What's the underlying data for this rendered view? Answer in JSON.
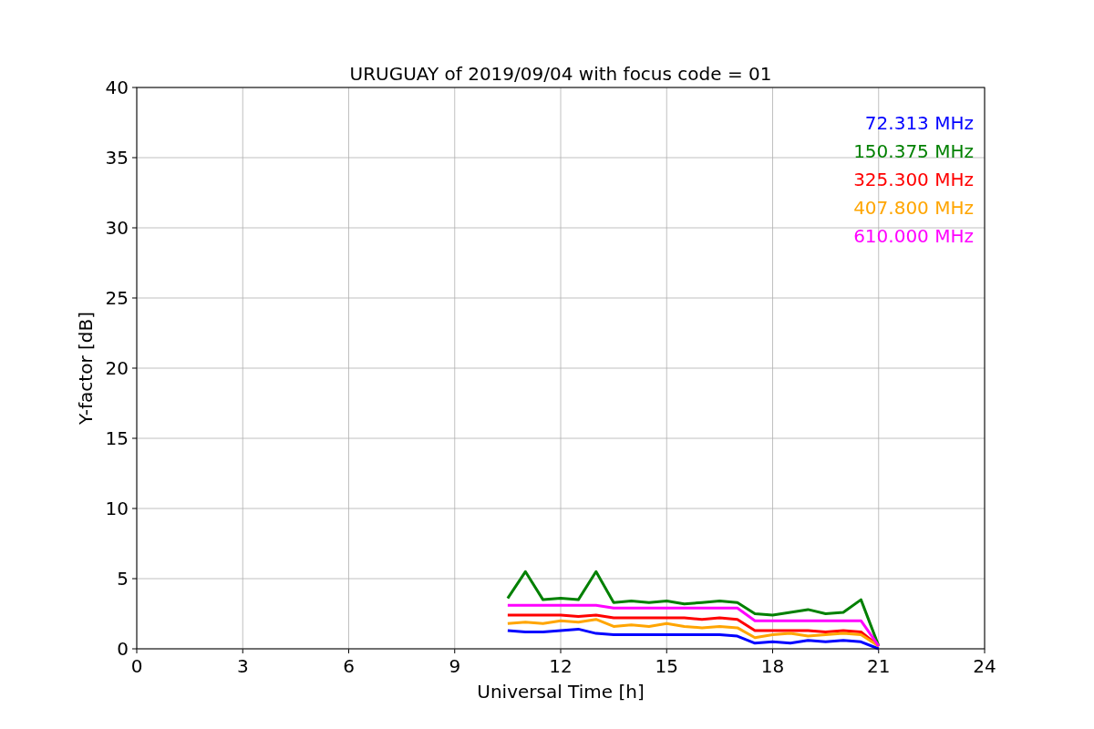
{
  "chart_data": {
    "type": "line",
    "title": "URUGUAY of 2019/09/04 with focus code = 01",
    "xlabel": "Universal Time [h]",
    "ylabel": "Y-factor [dB]",
    "x": [
      10.5,
      11,
      11.5,
      12,
      12.5,
      13,
      13.5,
      14,
      14.5,
      15,
      15.5,
      16,
      16.5,
      17,
      17.5,
      18,
      18.5,
      19,
      19.5,
      20,
      20.5,
      21
    ],
    "series": [
      {
        "name": "72.313 MHz",
        "color": "#0000ff",
        "values": [
          1.3,
          1.2,
          1.2,
          1.3,
          1.4,
          1.1,
          1.0,
          1.0,
          1.0,
          1.0,
          1.0,
          1.0,
          1.0,
          0.9,
          0.4,
          0.5,
          0.4,
          0.6,
          0.5,
          0.6,
          0.5,
          0.0
        ]
      },
      {
        "name": "150.375 MHz",
        "color": "#008000",
        "values": [
          3.6,
          5.5,
          3.5,
          3.6,
          3.5,
          5.5,
          3.3,
          3.4,
          3.3,
          3.4,
          3.2,
          3.3,
          3.4,
          3.3,
          2.5,
          2.4,
          2.6,
          2.8,
          2.5,
          2.6,
          3.5,
          0.2
        ]
      },
      {
        "name": "325.300 MHz",
        "color": "#ff0000",
        "values": [
          2.4,
          2.4,
          2.4,
          2.4,
          2.3,
          2.4,
          2.2,
          2.2,
          2.2,
          2.2,
          2.2,
          2.1,
          2.2,
          2.1,
          1.3,
          1.3,
          1.3,
          1.3,
          1.2,
          1.3,
          1.2,
          0.2
        ]
      },
      {
        "name": "407.800 MHz",
        "color": "#ffa500",
        "values": [
          1.8,
          1.9,
          1.8,
          2.0,
          1.9,
          2.1,
          1.6,
          1.7,
          1.6,
          1.8,
          1.6,
          1.5,
          1.6,
          1.5,
          0.8,
          1.0,
          1.1,
          0.9,
          1.0,
          1.1,
          1.0,
          0.2
        ]
      },
      {
        "name": "610.000 MHz",
        "color": "#ff00ff",
        "values": [
          3.1,
          3.1,
          3.1,
          3.1,
          3.1,
          3.1,
          2.9,
          2.9,
          2.9,
          2.9,
          2.9,
          2.9,
          2.9,
          2.9,
          2.0,
          2.0,
          2.0,
          2.0,
          2.0,
          2.0,
          2.0,
          0.2
        ]
      }
    ],
    "xlim": [
      0,
      24
    ],
    "ylim": [
      0,
      40
    ],
    "xticks": [
      0,
      3,
      6,
      9,
      12,
      15,
      18,
      21,
      24
    ],
    "yticks": [
      0,
      5,
      10,
      15,
      20,
      25,
      30,
      35,
      40
    ],
    "grid": true
  }
}
